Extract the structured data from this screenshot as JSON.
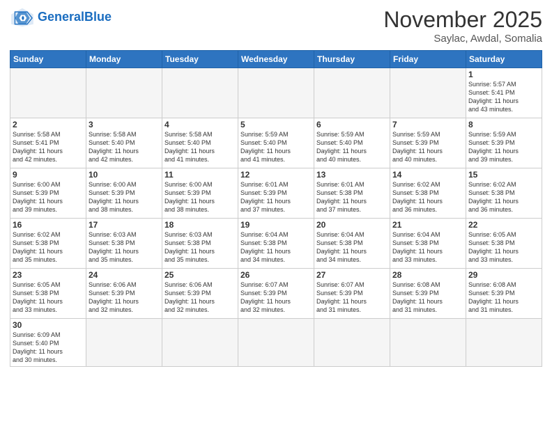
{
  "header": {
    "logo_general": "General",
    "logo_blue": "Blue",
    "month_title": "November 2025",
    "location": "Saylac, Awdal, Somalia"
  },
  "weekdays": [
    "Sunday",
    "Monday",
    "Tuesday",
    "Wednesday",
    "Thursday",
    "Friday",
    "Saturday"
  ],
  "weeks": [
    [
      {
        "day": "",
        "info": ""
      },
      {
        "day": "",
        "info": ""
      },
      {
        "day": "",
        "info": ""
      },
      {
        "day": "",
        "info": ""
      },
      {
        "day": "",
        "info": ""
      },
      {
        "day": "",
        "info": ""
      },
      {
        "day": "1",
        "info": "Sunrise: 5:57 AM\nSunset: 5:41 PM\nDaylight: 11 hours\nand 43 minutes."
      }
    ],
    [
      {
        "day": "2",
        "info": "Sunrise: 5:58 AM\nSunset: 5:41 PM\nDaylight: 11 hours\nand 42 minutes."
      },
      {
        "day": "3",
        "info": "Sunrise: 5:58 AM\nSunset: 5:40 PM\nDaylight: 11 hours\nand 42 minutes."
      },
      {
        "day": "4",
        "info": "Sunrise: 5:58 AM\nSunset: 5:40 PM\nDaylight: 11 hours\nand 41 minutes."
      },
      {
        "day": "5",
        "info": "Sunrise: 5:59 AM\nSunset: 5:40 PM\nDaylight: 11 hours\nand 41 minutes."
      },
      {
        "day": "6",
        "info": "Sunrise: 5:59 AM\nSunset: 5:40 PM\nDaylight: 11 hours\nand 40 minutes."
      },
      {
        "day": "7",
        "info": "Sunrise: 5:59 AM\nSunset: 5:39 PM\nDaylight: 11 hours\nand 40 minutes."
      },
      {
        "day": "8",
        "info": "Sunrise: 5:59 AM\nSunset: 5:39 PM\nDaylight: 11 hours\nand 39 minutes."
      }
    ],
    [
      {
        "day": "9",
        "info": "Sunrise: 6:00 AM\nSunset: 5:39 PM\nDaylight: 11 hours\nand 39 minutes."
      },
      {
        "day": "10",
        "info": "Sunrise: 6:00 AM\nSunset: 5:39 PM\nDaylight: 11 hours\nand 38 minutes."
      },
      {
        "day": "11",
        "info": "Sunrise: 6:00 AM\nSunset: 5:39 PM\nDaylight: 11 hours\nand 38 minutes."
      },
      {
        "day": "12",
        "info": "Sunrise: 6:01 AM\nSunset: 5:39 PM\nDaylight: 11 hours\nand 37 minutes."
      },
      {
        "day": "13",
        "info": "Sunrise: 6:01 AM\nSunset: 5:38 PM\nDaylight: 11 hours\nand 37 minutes."
      },
      {
        "day": "14",
        "info": "Sunrise: 6:02 AM\nSunset: 5:38 PM\nDaylight: 11 hours\nand 36 minutes."
      },
      {
        "day": "15",
        "info": "Sunrise: 6:02 AM\nSunset: 5:38 PM\nDaylight: 11 hours\nand 36 minutes."
      }
    ],
    [
      {
        "day": "16",
        "info": "Sunrise: 6:02 AM\nSunset: 5:38 PM\nDaylight: 11 hours\nand 35 minutes."
      },
      {
        "day": "17",
        "info": "Sunrise: 6:03 AM\nSunset: 5:38 PM\nDaylight: 11 hours\nand 35 minutes."
      },
      {
        "day": "18",
        "info": "Sunrise: 6:03 AM\nSunset: 5:38 PM\nDaylight: 11 hours\nand 35 minutes."
      },
      {
        "day": "19",
        "info": "Sunrise: 6:04 AM\nSunset: 5:38 PM\nDaylight: 11 hours\nand 34 minutes."
      },
      {
        "day": "20",
        "info": "Sunrise: 6:04 AM\nSunset: 5:38 PM\nDaylight: 11 hours\nand 34 minutes."
      },
      {
        "day": "21",
        "info": "Sunrise: 6:04 AM\nSunset: 5:38 PM\nDaylight: 11 hours\nand 33 minutes."
      },
      {
        "day": "22",
        "info": "Sunrise: 6:05 AM\nSunset: 5:38 PM\nDaylight: 11 hours\nand 33 minutes."
      }
    ],
    [
      {
        "day": "23",
        "info": "Sunrise: 6:05 AM\nSunset: 5:38 PM\nDaylight: 11 hours\nand 33 minutes."
      },
      {
        "day": "24",
        "info": "Sunrise: 6:06 AM\nSunset: 5:39 PM\nDaylight: 11 hours\nand 32 minutes."
      },
      {
        "day": "25",
        "info": "Sunrise: 6:06 AM\nSunset: 5:39 PM\nDaylight: 11 hours\nand 32 minutes."
      },
      {
        "day": "26",
        "info": "Sunrise: 6:07 AM\nSunset: 5:39 PM\nDaylight: 11 hours\nand 32 minutes."
      },
      {
        "day": "27",
        "info": "Sunrise: 6:07 AM\nSunset: 5:39 PM\nDaylight: 11 hours\nand 31 minutes."
      },
      {
        "day": "28",
        "info": "Sunrise: 6:08 AM\nSunset: 5:39 PM\nDaylight: 11 hours\nand 31 minutes."
      },
      {
        "day": "29",
        "info": "Sunrise: 6:08 AM\nSunset: 5:39 PM\nDaylight: 11 hours\nand 31 minutes."
      }
    ],
    [
      {
        "day": "30",
        "info": "Sunrise: 6:09 AM\nSunset: 5:40 PM\nDaylight: 11 hours\nand 30 minutes."
      },
      {
        "day": "",
        "info": ""
      },
      {
        "day": "",
        "info": ""
      },
      {
        "day": "",
        "info": ""
      },
      {
        "day": "",
        "info": ""
      },
      {
        "day": "",
        "info": ""
      },
      {
        "day": "",
        "info": ""
      }
    ]
  ]
}
